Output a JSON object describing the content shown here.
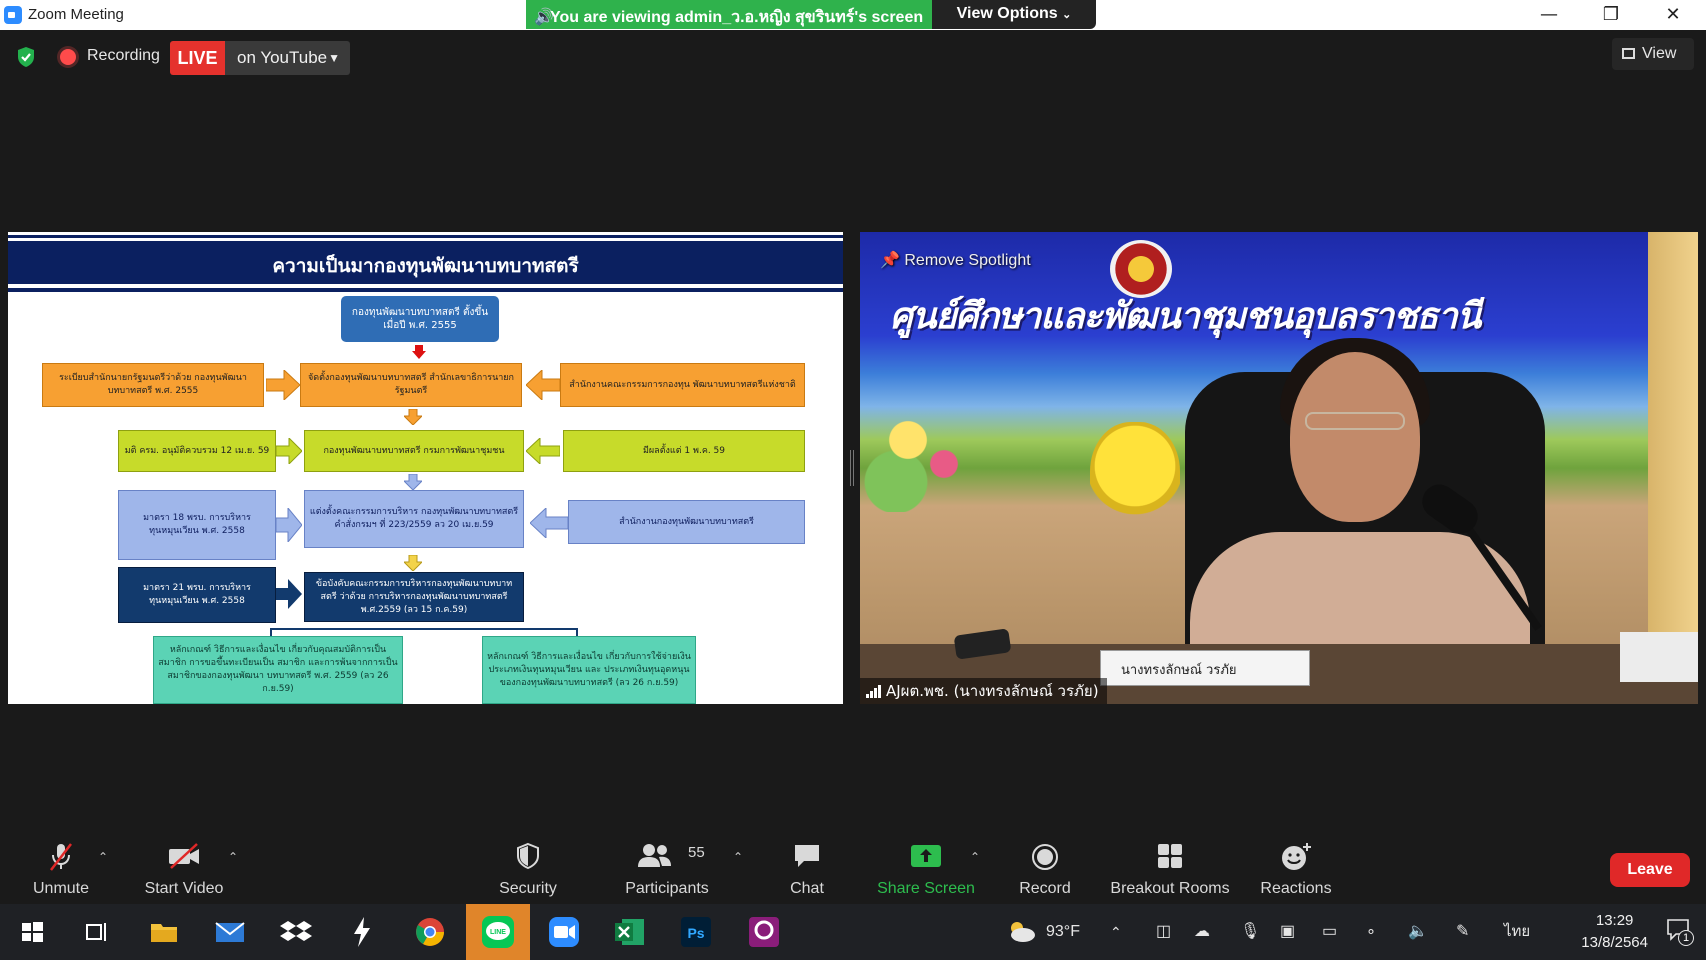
{
  "window": {
    "title": "Zoom Meeting",
    "viewing_banner": "You are viewing admin_ว.อ.หญิง สุขรินทร์'s screen",
    "view_options": "View Options"
  },
  "top_bar": {
    "recording_label": "Recording",
    "live_badge": "LIVE",
    "youtube_label": "on YouTube",
    "view_label": "View"
  },
  "slide": {
    "title": "ความเป็นมากองทุนพัฒนาบทบาทสตรี",
    "top_box": "กองทุนพัฒนาบทบาทสตรี ตั้งขึ้นเมื่อปี พ.ศ. 2555",
    "row1": {
      "left": "ระเบียบสำนักนายกรัฐมนตรีว่าด้วย กองทุนพัฒนาบทบาทสตรี พ.ศ. 2555",
      "center": "จัดตั้งกองทุนพัฒนาบทบาทสตรี สำนักเลขาธิการนายกรัฐมนตรี",
      "right": "สำนักงานคณะกรรมการกองทุน พัฒนาบทบาทสตรีแห่งชาติ"
    },
    "row2": {
      "left": "มติ ครม. อนุมัติควบรวม 12 เม.ย. 59",
      "center": "กองทุนพัฒนาบทบาทสตรี กรมการพัฒนาชุมชน",
      "right": "มีผลตั้งแต่ 1 พ.ค. 59"
    },
    "row3": {
      "left": "มาตรา 18 พรบ. การบริหารทุนหมุนเวียน พ.ศ. 2558",
      "center": "แต่งตั้งคณะกรรมการบริหาร กองทุนพัฒนาบทบาทสตรี คำสั่งกรมฯ ที่ 223/2559 ลว 20 เม.ย.59",
      "right": "สำนักงานกองทุนพัฒนาบทบาทสตรี"
    },
    "row4": {
      "left": "มาตรา 21 พรบ. การบริหารทุนหมุนเวียน พ.ศ. 2558",
      "center": "ข้อบังคับคณะกรรมการบริหารกองทุนพัฒนาบทบาท สตรี ว่าด้วย การบริหารกองทุนพัฒนาบทบาทสตรี พ.ศ.2559 (ลว 15 ก.ค.59)"
    },
    "row5": {
      "left": "หลักเกณฑ์ วิธีการและเงื่อนไข เกี่ยวกับคุณสมบัติการเป็นสมาชิก การขอขึ้นทะเบียนเป็น สมาชิก และการพ้นจากการเป็นสมาชิกของกองทุนพัฒนา บทบาทสตรี พ.ศ. 2559 (ลว 26 ก.ย.59)",
      "right": "หลักเกณฑ์ วิธีการและเงื่อนไข เกี่ยวกับการใช้จ่ายเงินประเภทเงินทุนหมุนเวียน และ ประเภทเงินทุนอุดหนุนของกองทุนพัฒนาบทบาทสตรี (ลว 26 ก.ย.59)"
    }
  },
  "video": {
    "remove_spotlight": "Remove Spotlight",
    "banner_text": "ศูนย์ศึกษาและพัฒนาชุมชนอุบลราชธานี",
    "participant_name": "AJผต.พช. (นางทรงลักษณ์ วรภัย)",
    "nameplate_text": "นางทรงลักษณ์ วรภัย"
  },
  "toolbar": {
    "unmute": "Unmute",
    "start_video": "Start Video",
    "security": "Security",
    "participants": "Participants",
    "participants_count": "55",
    "chat": "Chat",
    "share_screen": "Share Screen",
    "record": "Record",
    "breakout_rooms": "Breakout Rooms",
    "reactions": "Reactions",
    "leave": "Leave"
  },
  "taskbar": {
    "temperature": "93°F",
    "language": "ไทย",
    "time": "13:29",
    "date": "13/8/2564",
    "notification_count": "1"
  }
}
